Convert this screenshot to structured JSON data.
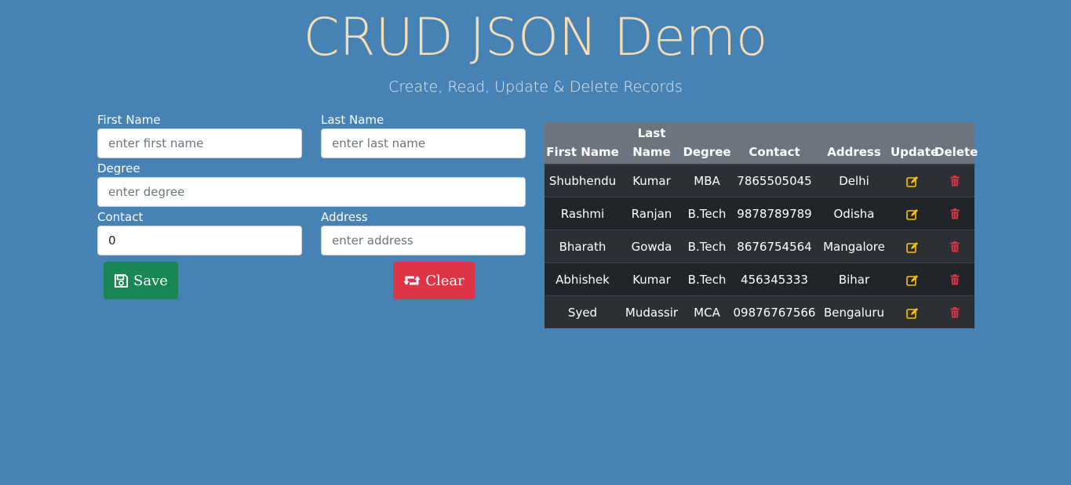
{
  "header": {
    "title": "CRUD JSON Demo",
    "subtitle": "Create, Read, Update & Delete Records"
  },
  "form": {
    "first_name": {
      "label": "First Name",
      "placeholder": "enter first name",
      "value": ""
    },
    "last_name": {
      "label": "Last Name",
      "placeholder": "enter last name",
      "value": ""
    },
    "degree": {
      "label": "Degree",
      "placeholder": "enter degree",
      "value": ""
    },
    "contact": {
      "label": "Contact",
      "placeholder": "",
      "value": "0"
    },
    "address": {
      "label": "Address",
      "placeholder": "enter address",
      "value": ""
    },
    "save_label": "Save",
    "save_icon": "floppy-disk-icon",
    "clear_label": "Clear",
    "clear_icon": "retweet-icon"
  },
  "table": {
    "columns": [
      "First Name",
      "Last Name",
      "Degree",
      "Contact",
      "Address",
      "Update",
      "Delete"
    ],
    "rows": [
      [
        "Shubhendu",
        "Kumar",
        "MBA",
        "7865505045",
        "Delhi"
      ],
      [
        "Rashmi",
        "Ranjan",
        "B.Tech",
        "9878789789",
        "Odisha"
      ],
      [
        "Bharath",
        "Gowda",
        "B.Tech",
        "8676754564",
        "Mangalore"
      ],
      [
        "Abhishek",
        "Kumar",
        "B.Tech",
        "456345333",
        "Bihar"
      ],
      [
        "Syed",
        "Mudassir",
        "MCA",
        "09876767566",
        "Bengaluru"
      ]
    ],
    "update_icon": "edit-icon",
    "delete_icon": "trash-icon"
  },
  "colors": {
    "background": "#4682b4",
    "title": "#f5deb3",
    "save": "#198754",
    "clear": "#dc3545",
    "update_icon": "#ffc107",
    "delete_icon": "#dc3545"
  }
}
